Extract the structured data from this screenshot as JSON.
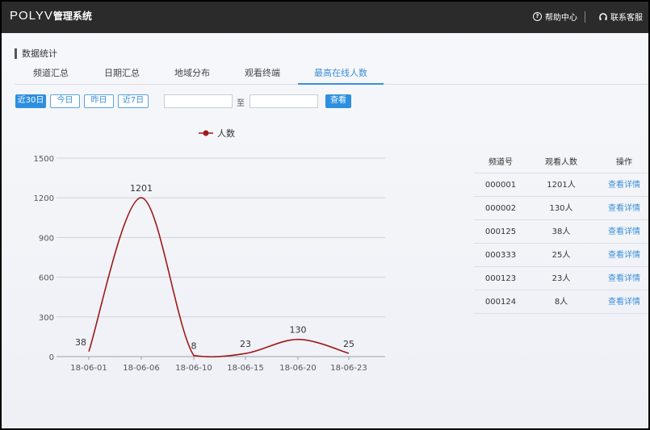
{
  "header": {
    "logo_text": "POLYV",
    "logo_system": "管理系统",
    "help_label": "帮助中心",
    "support_label": "联系客服"
  },
  "page": {
    "section_title": "数据统计",
    "tabs": [
      {
        "label": "频道汇总",
        "active": false
      },
      {
        "label": "日期汇总",
        "active": false
      },
      {
        "label": "地域分布",
        "active": false
      },
      {
        "label": "观看终端",
        "active": false
      },
      {
        "label": "最高在线人数",
        "active": true
      }
    ]
  },
  "filters": {
    "quick": [
      {
        "label": "近30日",
        "active": true
      },
      {
        "label": "今日",
        "active": false
      },
      {
        "label": "昨日",
        "active": false
      },
      {
        "label": "近7日",
        "active": false
      }
    ],
    "start_value": "",
    "end_value": "",
    "to_label": "至",
    "query_label": "查看"
  },
  "chart_data": {
    "type": "line",
    "series": [
      {
        "name": "人数",
        "color": "#a01818",
        "points": [
          {
            "x": "18-06-01",
            "y": 38,
            "label": "38"
          },
          {
            "x": "18-06-06",
            "y": 1201,
            "label": "1201"
          },
          {
            "x": "18-06-10",
            "y": 8,
            "label": "8"
          },
          {
            "x": "18-06-15",
            "y": 23,
            "label": "23"
          },
          {
            "x": "18-06-20",
            "y": 130,
            "label": "130"
          },
          {
            "x": "18-06-23",
            "y": 25,
            "label": "25"
          }
        ]
      }
    ],
    "x_ticks": [
      "18-06-01",
      "18-06-06",
      "18-06-10",
      "18-06-15",
      "18-06-20",
      "18-06-23"
    ],
    "y_ticks": [
      0,
      300,
      600,
      900,
      1200,
      1500
    ],
    "ylim": [
      0,
      1500
    ],
    "grid": true,
    "legend": "top"
  },
  "table": {
    "headers": [
      "频道号",
      "观看人数",
      "操作"
    ],
    "rows": [
      {
        "channel": "000001",
        "viewers": "1201人",
        "action": "查看详情"
      },
      {
        "channel": "000002",
        "viewers": "130人",
        "action": "查看详情"
      },
      {
        "channel": "000125",
        "viewers": "38人",
        "action": "查看详情"
      },
      {
        "channel": "000333",
        "viewers": "25人",
        "action": "查看详情"
      },
      {
        "channel": "000123",
        "viewers": "23人",
        "action": "查看详情"
      },
      {
        "channel": "000124",
        "viewers": "8人",
        "action": "查看详情"
      }
    ]
  }
}
